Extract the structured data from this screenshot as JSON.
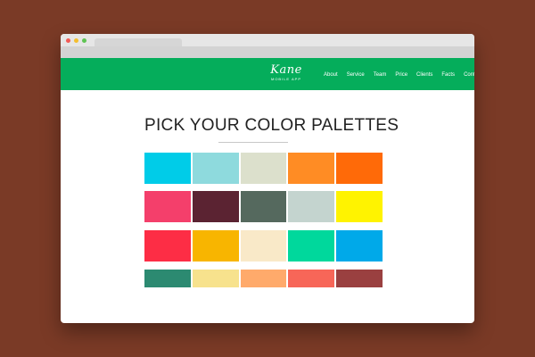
{
  "browser": {
    "window_buttons": [
      {
        "name": "close",
        "color": "#f25a56"
      },
      {
        "name": "minimize",
        "color": "#f4be2f"
      },
      {
        "name": "maximize",
        "color": "#5fc453"
      }
    ]
  },
  "nav": {
    "background": "#05ad5b",
    "logo_main": "Kane",
    "logo_sub": "MOBILE APP",
    "items": [
      "About",
      "Service",
      "Team",
      "Price",
      "Clients",
      "Facts",
      "Contact"
    ]
  },
  "main": {
    "heading": "PICK YOUR COLOR PALETTES",
    "palettes": [
      [
        "#00cce8",
        "#8edadd",
        "#dce0cc",
        "#ff8c24",
        "#ff6a08"
      ],
      [
        "#f43f6b",
        "#5b2332",
        "#55695e",
        "#c4d4cf",
        "#fff300"
      ],
      [
        "#fd2d45",
        "#f8b500",
        "#f9e9c8",
        "#00d89c",
        "#00a9e9"
      ],
      [
        "#2c8a71",
        "#f7e28d",
        "#ffaa6b",
        "#f76658",
        "#9a4040"
      ]
    ]
  }
}
